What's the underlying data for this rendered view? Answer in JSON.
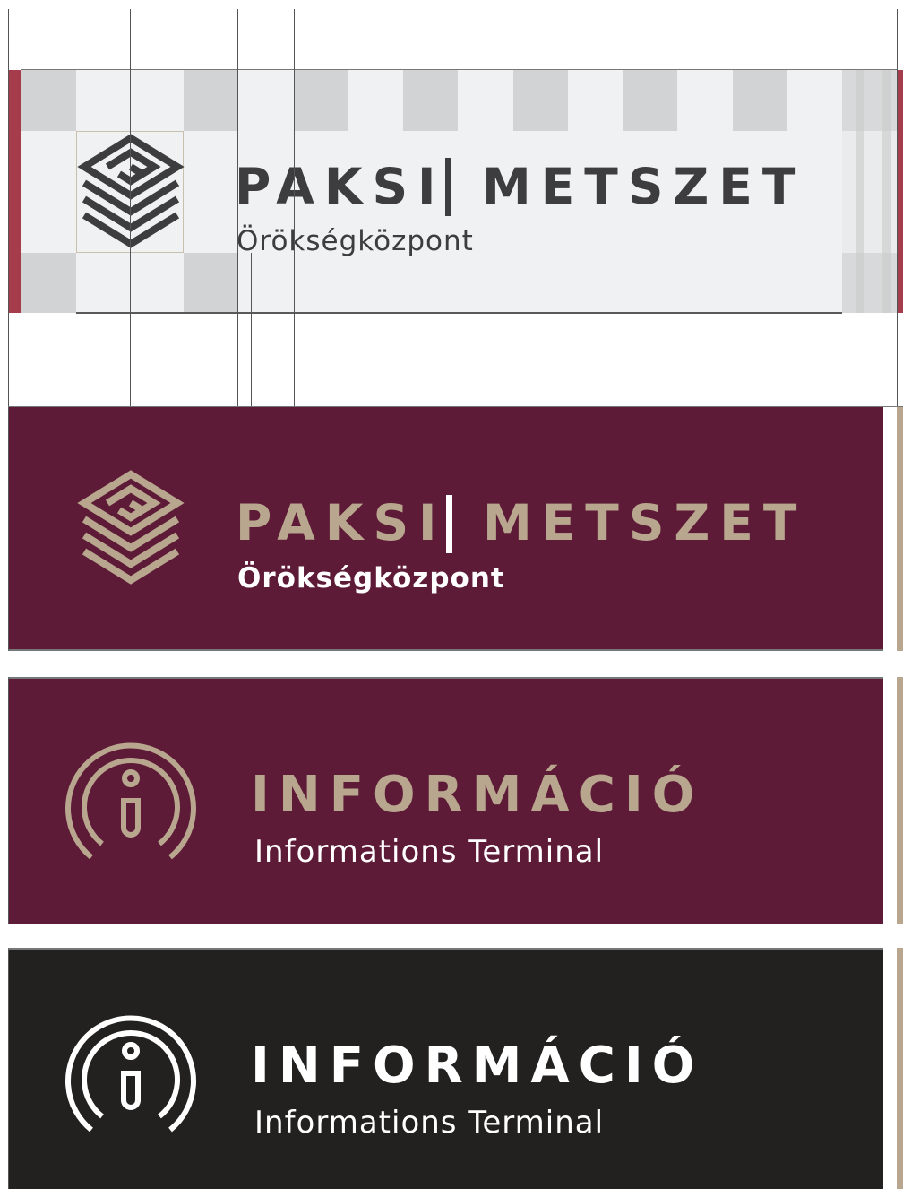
{
  "colors": {
    "maroon": "#5e1b37",
    "beige": "#b8a68e",
    "dark_gray": "#3d3d3f",
    "light_panel": "#eff1f2",
    "grid_square": "#d1d3d4",
    "black_panel": "#222120",
    "accent_red": "#a53c4c",
    "white": "#ffffff"
  },
  "signs": [
    {
      "id": "grid-template",
      "title_left": "PAKSI",
      "title_right": "METSZET",
      "subtitle": "Örökségközpont",
      "icon": "labyrinth-logo-icon"
    },
    {
      "id": "maroon-logo",
      "title_left": "PAKSI",
      "title_right": "METSZET",
      "subtitle": "Örökségközpont",
      "icon": "labyrinth-logo-icon"
    },
    {
      "id": "maroon-info",
      "title": "INFORMÁCIÓ",
      "subtitle": "Informations Terminal",
      "icon": "info-icon"
    },
    {
      "id": "black-info",
      "title": "INFORMÁCIÓ",
      "subtitle": "Informations Terminal",
      "icon": "info-icon"
    }
  ]
}
